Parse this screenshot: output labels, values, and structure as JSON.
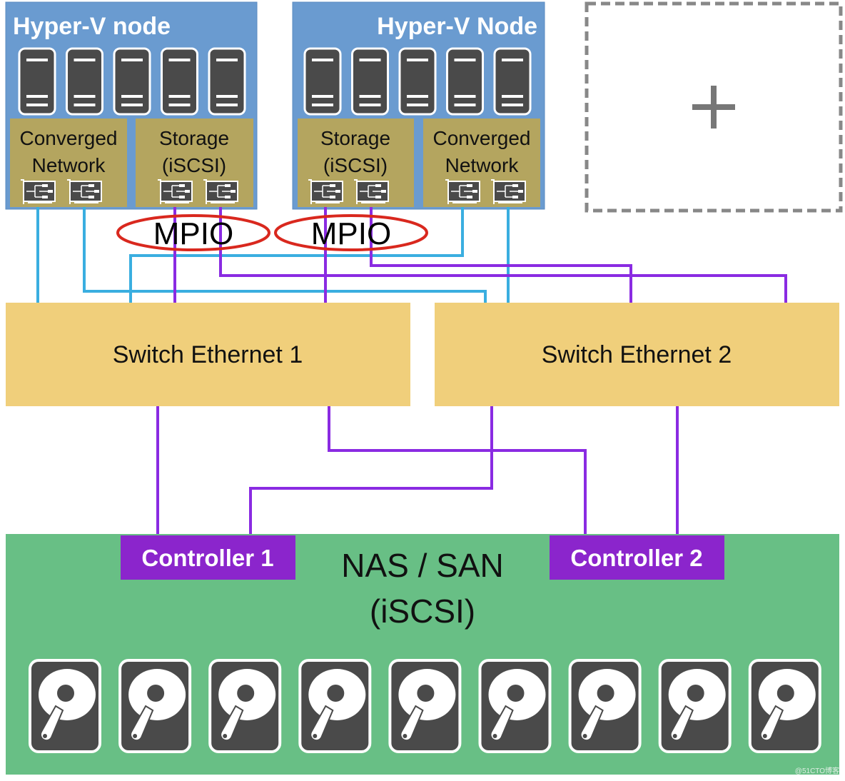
{
  "node_1": {
    "title": "Hyper-V node",
    "group_a_l1": "Converged",
    "group_a_l2": "Network",
    "group_b_l1": "Storage",
    "group_b_l2": "(iSCSI)"
  },
  "node_2": {
    "title": "Hyper-V Node",
    "group_a_l1": "Storage",
    "group_a_l2": "(iSCSI)",
    "group_b_l1": "Converged",
    "group_b_l2": "Network"
  },
  "add_placeholder": {
    "icon": "plus-icon"
  },
  "mpio": [
    "MPIO",
    "MPIO"
  ],
  "switches": [
    "Switch Ethernet 1",
    "Switch Ethernet 2"
  ],
  "storage": {
    "title_l1": "NAS / SAN",
    "title_l2": "(iSCSI)",
    "controllers": [
      "Controller 1",
      "Controller 2"
    ],
    "disk_count": 9
  },
  "servers_per_node": 5,
  "watermark": "@51CTO博客",
  "colors": {
    "node": "#6A9BD0",
    "nic_group": "#B4A55F",
    "switch": "#F0CF7B",
    "nas": "#68BF85",
    "controller": "#8B25CC",
    "network_link": "#3AAEE0",
    "storage_link": "#8A2BE2",
    "mpio_ellipse": "#D9281E",
    "server": "#4A4A4A"
  }
}
